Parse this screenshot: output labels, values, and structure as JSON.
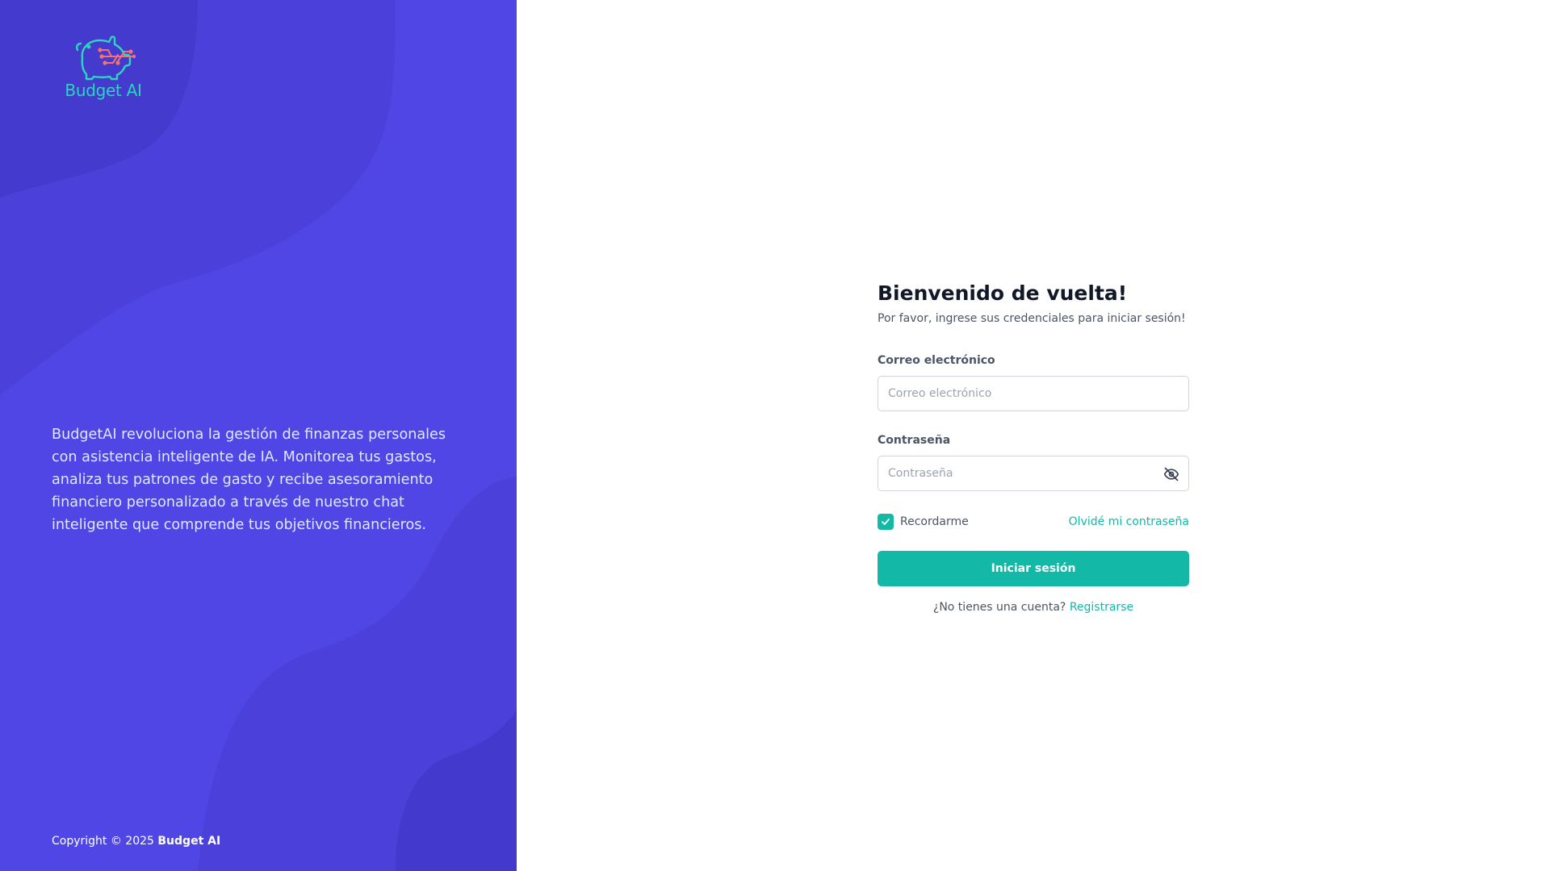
{
  "brand": {
    "logo_text": "Budget AI",
    "description": "BudgetAI revoluciona la gestión de finanzas personales con asistencia inteligente de IA. Monitorea tus gastos, analiza tus patrones de gasto y recibe asesoramiento financiero personalizado a través de nuestro chat inteligente que comprende tus objetivos financieros.",
    "copyright_prefix": "Copyright © 2025",
    "copyright_name": "Budget AI",
    "colors": {
      "panel_bg": "#4f46e5",
      "panel_shape_dark": "#4338ca",
      "logo_teal": "#2dd4bf",
      "logo_coral": "#f87171"
    }
  },
  "login": {
    "title": "Bienvenido de vuelta!",
    "subtitle": "Por favor, ingrese sus credenciales para iniciar sesión!",
    "email": {
      "label": "Correo electrónico",
      "placeholder": "Correo electrónico",
      "value": ""
    },
    "password": {
      "label": "Contraseña",
      "placeholder": "Contraseña",
      "value": "",
      "toggle_icon": "eye-off-icon"
    },
    "remember": {
      "label": "Recordarme",
      "checked": true
    },
    "forgot_label": "Olvidé mi contraseña",
    "submit_label": "Iniciar sesión",
    "signup_prompt": "¿No tienes una cuenta?",
    "signup_label": "Registrarse",
    "colors": {
      "accent": "#14b8a6",
      "title": "#111827",
      "text": "#4b5563",
      "border": "#d1d5db"
    }
  }
}
